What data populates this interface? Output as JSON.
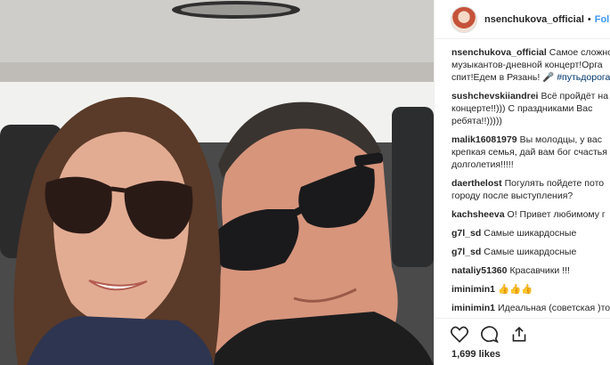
{
  "post": {
    "username": "nsenchukova_official",
    "follow_label": "Follo",
    "separator": "•"
  },
  "caption": {
    "username": "nsenchukova_official",
    "line1": "Самое сложно",
    "line2": "музыкантов-дневной концерт!Орга",
    "line3_text": "спит!Едем в Рязань! 🎤 ",
    "line3_tag": "#путьдорога"
  },
  "comments": [
    {
      "user": "sushchevskiiandrei",
      "lines": [
        "Всё пройдёт на",
        "концерте!!))) С праздниками Вас",
        "ребята!!)))))"
      ]
    },
    {
      "user": "malik16081979",
      "lines": [
        "Вы молодцы, у вас",
        "крепкая семья, дай вам бог счастья",
        "долголетия!!!!!"
      ]
    },
    {
      "user": "daerthelost",
      "lines": [
        "Погулять пойдете пото",
        "городу после выступления?"
      ]
    },
    {
      "user": "kachsheeva",
      "lines": [
        "О! Привет любимому г"
      ]
    },
    {
      "user": "g7l_sd",
      "lines": [
        "Самые шикардосные"
      ]
    },
    {
      "user": "g7l_sd",
      "lines": [
        "Самые шикардосные"
      ]
    },
    {
      "user": "nataliy51360",
      "lines": [
        "Красавчики !!!"
      ]
    },
    {
      "user": "iminimin1",
      "lines": [
        "👍👍👍"
      ]
    },
    {
      "user": "iminimin1",
      "lines": [
        "Идеальная (советская )то"
      ]
    }
  ],
  "icons": [
    "heart-icon",
    "comment-icon",
    "share-icon"
  ],
  "likes_text": "1,699 likes"
}
